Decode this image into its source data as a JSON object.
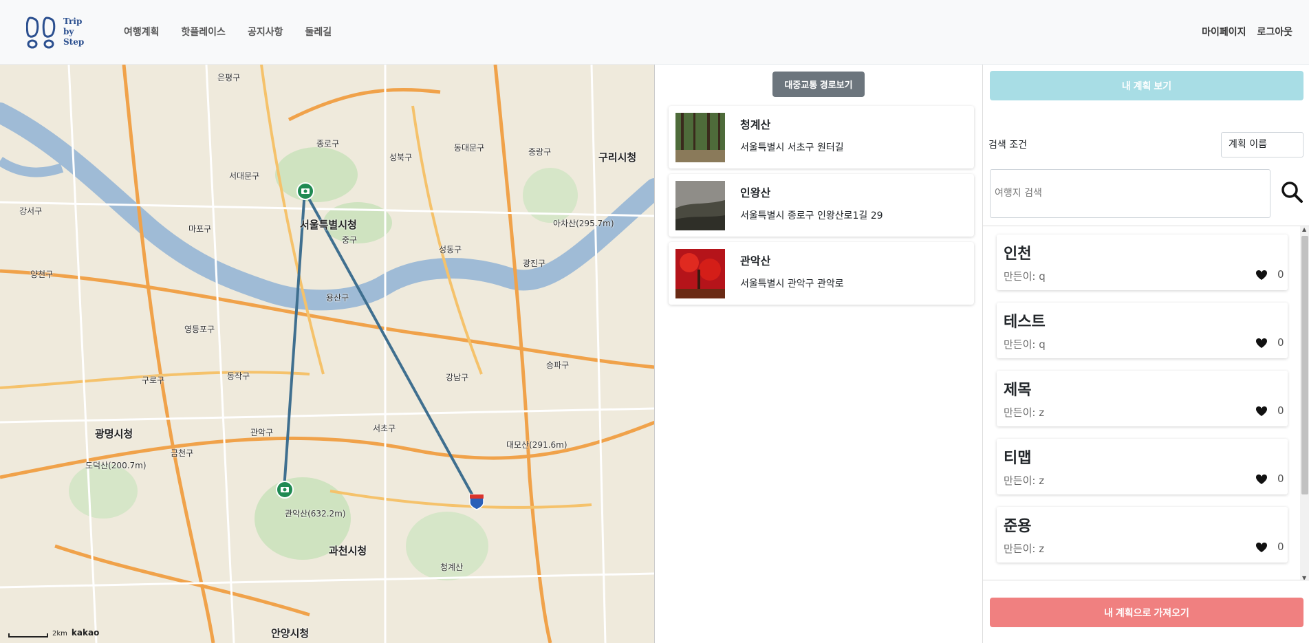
{
  "header": {
    "logo_text": [
      "Trip",
      "by",
      "Step"
    ],
    "nav": [
      "여행계획",
      "핫플레이스",
      "공지사항",
      "둘레길"
    ],
    "right_nav": [
      "마이페이지",
      "로그아웃"
    ]
  },
  "map": {
    "labels": [
      "은평구",
      "종로구",
      "서대문구",
      "서울특별시청",
      "중구",
      "성북구",
      "동대문구",
      "중랑구",
      "구리시청",
      "마포구",
      "용산구",
      "성동구",
      "광진구",
      "영등포구",
      "동작구",
      "구로구",
      "관악구",
      "서초구",
      "강남구",
      "송파구",
      "광명시청",
      "금천구",
      "과천시청",
      "안양시청",
      "아차산(295.7m)",
      "관악산(632.2m)",
      "대모산(291.6m)",
      "도덕산(200.7m)",
      "청계산",
      "양천구",
      "강서구"
    ],
    "scale": "2km",
    "brand": "kakao"
  },
  "middle": {
    "route_button": "대중교통 경로보기",
    "places": [
      {
        "name": "청계산",
        "address": "서울특별시 서초구 원터길"
      },
      {
        "name": "인왕산",
        "address": "서울특별시 종로구 인왕산로1길 29"
      },
      {
        "name": "관악산",
        "address": "서울특별시 관악구 관악로"
      }
    ]
  },
  "right": {
    "my_plan_button": "내 계획 보기",
    "search_condition_label": "검색 조건",
    "search_condition_value": "계획 이름",
    "search_placeholder": "여행지 검색",
    "plans": [
      {
        "title": "인천",
        "maker": "만든이: q",
        "likes": "0"
      },
      {
        "title": "테스트",
        "maker": "만든이: q",
        "likes": "0"
      },
      {
        "title": "제목",
        "maker": "만든이: z",
        "likes": "0"
      },
      {
        "title": "티맵",
        "maker": "만든이: z",
        "likes": "0"
      },
      {
        "title": "준용",
        "maker": "만든이: z",
        "likes": "0"
      }
    ],
    "import_button": "내 계획으로 가져오기"
  },
  "colors": {
    "route_btn": "#6c757d",
    "my_plan_btn": "#a8dde5",
    "import_btn": "#f08080",
    "river": "#9fbbd6",
    "route_line": "#3f6f8f"
  }
}
